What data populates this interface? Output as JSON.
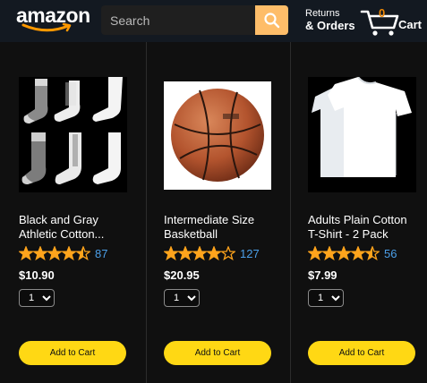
{
  "header": {
    "logo_text": "amazon",
    "search_placeholder": "Search",
    "returns_top": "Returns",
    "returns_bottom": "& Orders",
    "cart_count": "0",
    "cart_label": "Cart"
  },
  "colors": {
    "header_bg": "#131921",
    "page_bg": "#101010",
    "search_button": "#febd69",
    "star": "#ffa41c",
    "review_link": "#4b9fe8",
    "add_button": "#ffd814",
    "cart_count": "#f08804"
  },
  "icons": {
    "search": "search-icon",
    "cart": "cart-icon",
    "star": "star-icon"
  },
  "products": [
    {
      "title_line1": "Black and Gray",
      "title_line2": "Athletic Cotton...",
      "rating": 4.5,
      "review_count": "87",
      "price": "$10.90",
      "quantity": "1",
      "add_label": "Add to Cart",
      "image": "socks"
    },
    {
      "title_line1": "Intermediate Size",
      "title_line2": "Basketball",
      "rating": 4.0,
      "review_count": "127",
      "price": "$20.95",
      "quantity": "1",
      "add_label": "Add to Cart",
      "image": "basketball"
    },
    {
      "title_line1": "Adults Plain Cotton",
      "title_line2": "T-Shirt - 2 Pack",
      "rating": 4.5,
      "review_count": "56",
      "price": "$7.99",
      "quantity": "1",
      "add_label": "Add to Cart",
      "image": "tshirts"
    }
  ]
}
